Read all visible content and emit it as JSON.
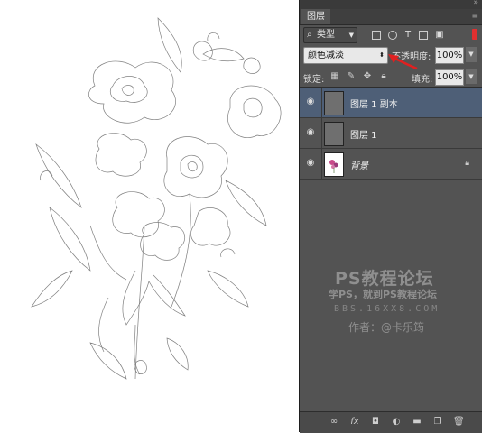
{
  "panel": {
    "tab_title": "图层",
    "filter": {
      "kind_label": "类型"
    },
    "blend_mode": "颜色减淡",
    "opacity_label": "不透明度:",
    "opacity_value": "100%",
    "lock_label": "锁定:",
    "fill_label": "填充:",
    "fill_value": "100%",
    "layers": [
      {
        "name": "图层 1 副本",
        "selected": true,
        "visible": true,
        "thumb": "gray"
      },
      {
        "name": "图层 1",
        "selected": false,
        "visible": true,
        "thumb": "gray"
      },
      {
        "name": "背景",
        "selected": false,
        "visible": true,
        "thumb": "white",
        "locked": true
      }
    ],
    "bottom_icons": [
      "link-icon",
      "fx-icon",
      "mask-icon",
      "adjustment-icon",
      "folder-icon",
      "new-layer-icon",
      "trash-icon"
    ]
  },
  "watermark": {
    "line1": "PS教程论坛",
    "line2": "学PS，就到PS教程论坛",
    "line3": "BBS.16XX8.COM",
    "line4": "作者：@卡乐筠"
  },
  "colors": {
    "panel_bg": "#535353",
    "selected_row": "#4e5f77",
    "accent_red": "#e03030"
  }
}
